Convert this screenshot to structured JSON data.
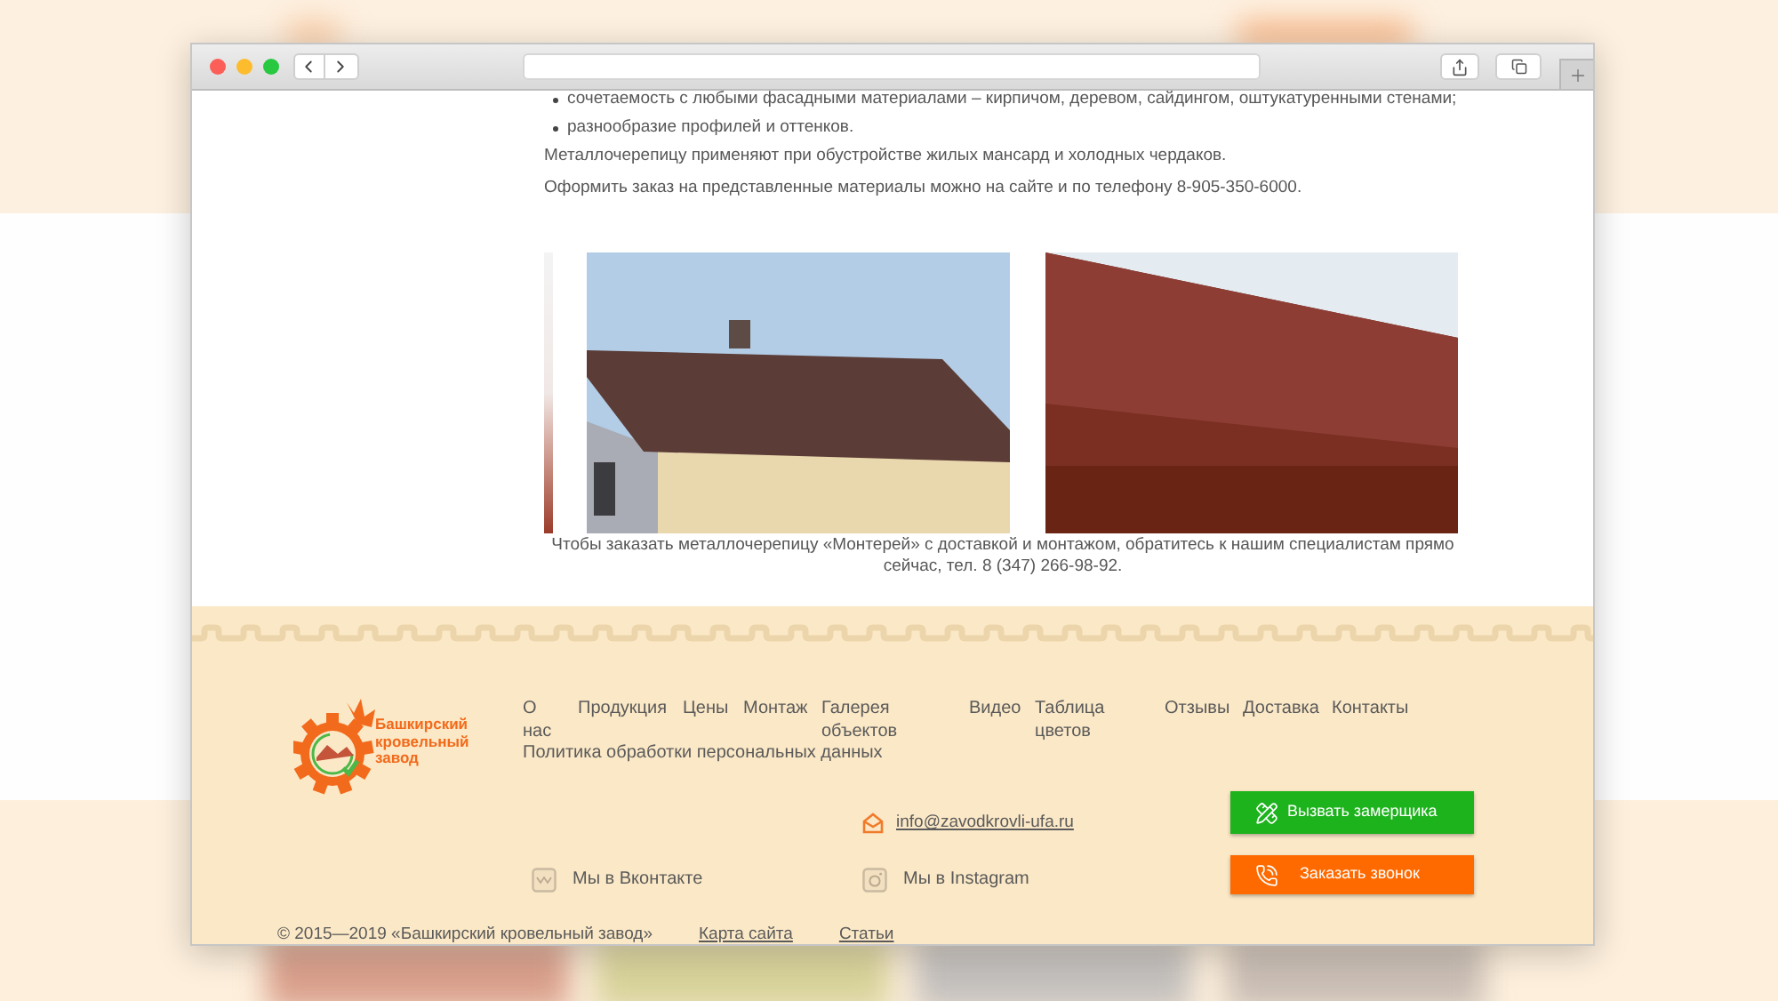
{
  "content": {
    "bullets": [
      "сочетаемость с любыми фасадными материалами – кирпичом, деревом, сайдингом, оштукатуренными стенами;",
      "разнообразие профилей и оттенков."
    ],
    "paragraphs": [
      "Металлочерепицу применяют при обустройстве жилых мансард и холодных чердаков.",
      "Оформить заказ на представленные материалы можно на сайте и по телефону 8-905-350-6000."
    ],
    "caption": "Чтобы заказать металлочерепицу «Монтерей» с доставкой и монтажом, обратитесь к нашим специалистам прямо сейчас, тел. 8 (347) 266-98-92."
  },
  "footer": {
    "logo_text": "Башкирский кровельный завод",
    "nav": [
      "О нас",
      "Продукция",
      "Цены",
      "Монтаж",
      "Галерея объектов",
      "Видео",
      "Таблица цветов",
      "Отзывы",
      "Доставка",
      "Контакты",
      "Политика обработки персональных данных"
    ],
    "email": "info@zavodkrovli-ufa.ru",
    "social": [
      {
        "label": "Мы в Вконтакте",
        "kind": "vk"
      },
      {
        "label": "Мы в Instagram",
        "kind": "instagram"
      }
    ],
    "buttons": [
      {
        "label": "Вызвать замерщика",
        "kind": "measure",
        "color": "#1db31d"
      },
      {
        "label": "Заказать звонок",
        "kind": "call",
        "color": "#ff6a00"
      }
    ],
    "copyright": "© 2015—2019 «Башкирский кровельный завод»",
    "links": [
      "Карта сайта",
      "Статьи"
    ]
  }
}
